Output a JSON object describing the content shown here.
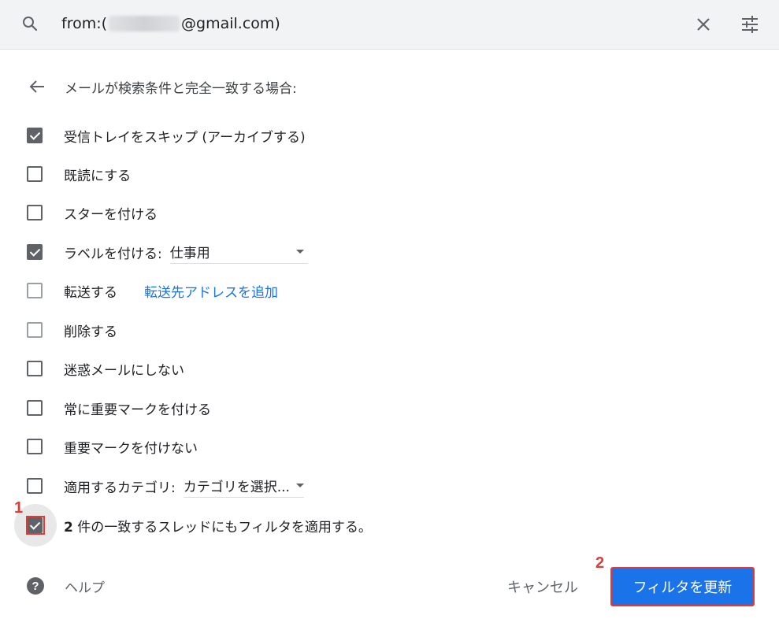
{
  "search": {
    "query_prefix": "from:(",
    "query_suffix": "@gmail.com)"
  },
  "filter": {
    "heading": "メールが検索条件と完全一致する場合:",
    "options": [
      {
        "label": "受信トレイをスキップ (アーカイブする)",
        "checked": true
      },
      {
        "label": "既読にする",
        "checked": false
      },
      {
        "label": "スターを付ける",
        "checked": false
      },
      {
        "label": "ラベルを付ける:",
        "checked": true,
        "select_value": "仕事用"
      },
      {
        "label": "転送する",
        "checked": false,
        "link": "転送先アドレスを追加"
      },
      {
        "label": "削除する",
        "checked": false
      },
      {
        "label": "迷惑メールにしない",
        "checked": false
      },
      {
        "label": "常に重要マークを付ける",
        "checked": false
      },
      {
        "label": "重要マークを付けない",
        "checked": false
      },
      {
        "label": "適用するカテゴリ:",
        "checked": false,
        "select_value": "カテゴリを選択..."
      },
      {
        "label_bold": "2",
        "label": " 件の一致するスレッドにもフィルタを適用する。",
        "checked": true
      }
    ]
  },
  "footer": {
    "help": "ヘルプ",
    "cancel": "キャンセル",
    "update": "フィルタを更新"
  },
  "annotations": {
    "marker1": "1",
    "marker2": "2"
  },
  "colors": {
    "accent": "#1a73e8",
    "annotation": "#e53935",
    "checkbox": "#5f6368"
  },
  "icons": [
    "search-icon",
    "close-icon",
    "tune-icon",
    "back-arrow-icon",
    "dropdown-caret-icon",
    "help-icon"
  ]
}
